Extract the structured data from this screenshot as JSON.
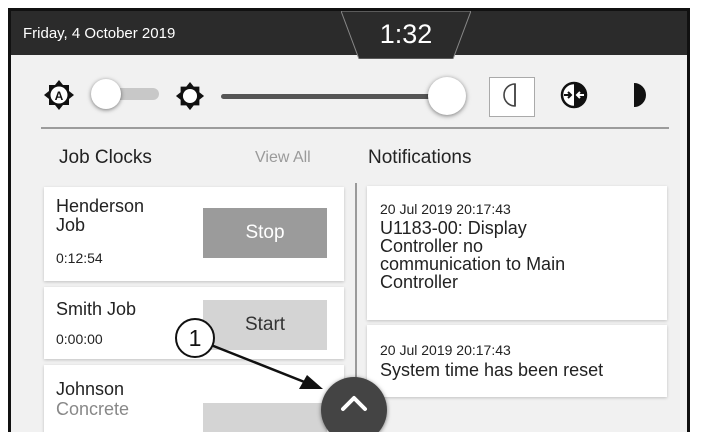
{
  "status_bar": {
    "date": "Friday, 4 October 2019",
    "time": "1:32"
  },
  "display_controls": {
    "auto_brightness_icon": "auto-brightness-icon",
    "auto_brightness_on": false,
    "brightness_icon": "sun-icon",
    "brightness_level": 0.95,
    "theme_options": [
      {
        "icon": "day-mode-icon",
        "selected": true
      },
      {
        "icon": "auto-contrast-icon",
        "selected": false
      },
      {
        "icon": "night-mode-icon",
        "selected": false
      }
    ]
  },
  "job_clocks": {
    "title": "Job Clocks",
    "view_all": "View All",
    "jobs": [
      {
        "name_line1": "Henderson",
        "name_line2": "Job",
        "elapsed": "0:12:54",
        "button": "Stop"
      },
      {
        "name": "Smith Job",
        "elapsed": "0:00:00",
        "button": "Start"
      },
      {
        "name_line1": "Johnson",
        "name_line2": "Concrete"
      }
    ]
  },
  "notifications": {
    "title": "Notifications",
    "items": [
      {
        "timestamp": "20 Jul 2019 20:17:43",
        "message_lines": [
          "U1183-00: Display",
          "Controller no",
          "communication to Main",
          "Controller"
        ]
      },
      {
        "timestamp": "20 Jul 2019 20:17:43",
        "message": "System time has been reset"
      }
    ]
  },
  "expand_button_icon": "chevron-up-icon",
  "callout_label": "1"
}
